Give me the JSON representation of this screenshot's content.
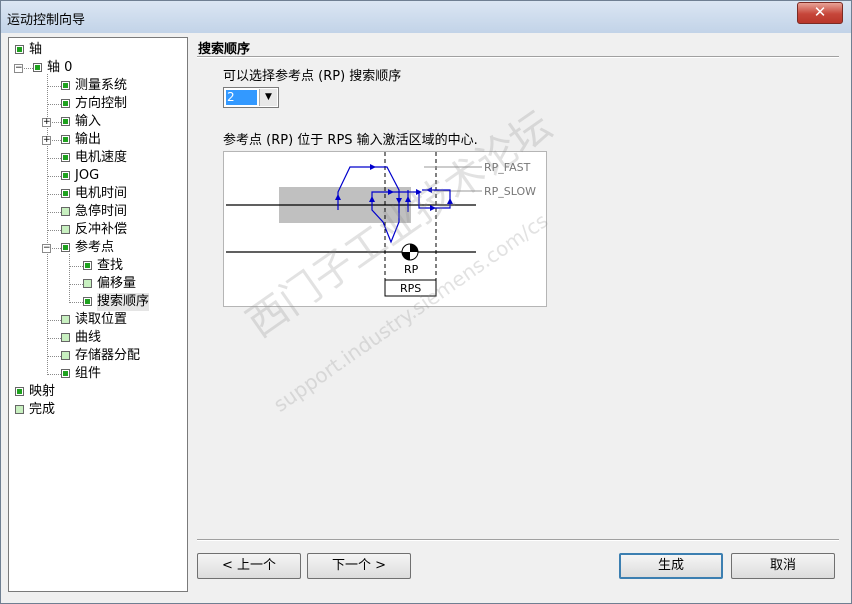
{
  "window": {
    "title": "运动控制向导",
    "close_glyph": "✕"
  },
  "tree": {
    "items": [
      {
        "label": "轴",
        "level": 0,
        "checked": true,
        "expander": ""
      },
      {
        "label": "轴 0",
        "level": 1,
        "checked": true,
        "expander": "−"
      },
      {
        "label": "测量系统",
        "level": 2,
        "checked": true,
        "expander": ""
      },
      {
        "label": "方向控制",
        "level": 2,
        "checked": true,
        "expander": ""
      },
      {
        "label": "输入",
        "level": 2,
        "checked": true,
        "expander": "+"
      },
      {
        "label": "输出",
        "level": 2,
        "checked": true,
        "expander": "+"
      },
      {
        "label": "电机速度",
        "level": 2,
        "checked": true,
        "expander": ""
      },
      {
        "label": "JOG",
        "level": 2,
        "checked": true,
        "expander": ""
      },
      {
        "label": "电机时间",
        "level": 2,
        "checked": true,
        "expander": ""
      },
      {
        "label": "急停时间",
        "level": 2,
        "checked": false,
        "expander": ""
      },
      {
        "label": "反冲补偿",
        "level": 2,
        "checked": false,
        "expander": ""
      },
      {
        "label": "参考点",
        "level": 2,
        "checked": true,
        "expander": "−"
      },
      {
        "label": "查找",
        "level": 3,
        "checked": true,
        "expander": ""
      },
      {
        "label": "偏移量",
        "level": 3,
        "checked": false,
        "expander": ""
      },
      {
        "label": "搜索顺序",
        "level": 3,
        "checked": true,
        "expander": "",
        "selected": true
      },
      {
        "label": "读取位置",
        "level": 2,
        "checked": false,
        "expander": ""
      },
      {
        "label": "曲线",
        "level": 2,
        "checked": false,
        "expander": ""
      },
      {
        "label": "存储器分配",
        "level": 2,
        "checked": false,
        "expander": ""
      },
      {
        "label": "组件",
        "level": 2,
        "checked": true,
        "expander": ""
      },
      {
        "label": "映射",
        "level": 0,
        "checked": true,
        "expander": ""
      },
      {
        "label": "完成",
        "level": 0,
        "checked": false,
        "expander": ""
      }
    ]
  },
  "page": {
    "title": "搜索顺序",
    "prompt": "可以选择参考点 (RP) 搜索顺序",
    "sequence_value": "2",
    "description": "参考点 (RP) 位于 RPS 输入激活区域的中心."
  },
  "diagram": {
    "label_fast": "RP_FAST",
    "label_slow": "RP_SLOW",
    "label_rp": "RP",
    "label_rps": "RPS",
    "line_color": "#0000cc",
    "zone_color": "#c0c0c0"
  },
  "buttons": {
    "prev": "< 上一个",
    "next": "下一个 >",
    "generate": "生成",
    "cancel": "取消"
  },
  "watermark": {
    "line1": "西门子工业技术论坛",
    "line2": "support.industry.siemens.com/cs"
  }
}
